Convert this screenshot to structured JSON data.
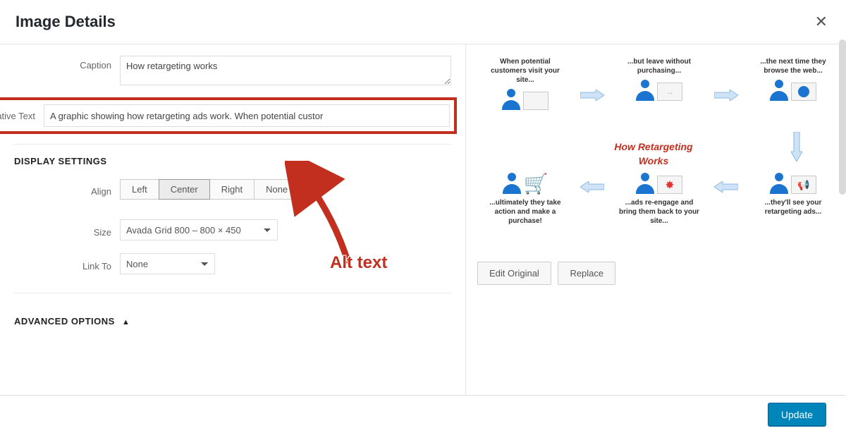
{
  "header": {
    "title": "Image Details"
  },
  "form": {
    "caption_label": "Caption",
    "caption_value": "How retargeting works",
    "alt_label": "Alternative Text",
    "alt_value": "A graphic showing how retargeting ads work. When potential custor"
  },
  "display": {
    "section_title": "DISPLAY SETTINGS",
    "align_label": "Align",
    "align_options": [
      "Left",
      "Center",
      "Right",
      "None"
    ],
    "align_selected": "Center",
    "size_label": "Size",
    "size_value": "Avada Grid 800 – 800 × 450",
    "linkto_label": "Link To",
    "linkto_value": "None"
  },
  "advanced": {
    "title": "ADVANCED OPTIONS"
  },
  "annotation": {
    "callout": "Alt text"
  },
  "preview": {
    "edit_label": "Edit Original",
    "replace_label": "Replace",
    "title": "How Retargeting Works",
    "steps": {
      "s1": "When potential customers visit your site...",
      "s2": "...but leave without purchasing...",
      "s3": "...the next time they browse the web...",
      "s4": "...they'll see your retargeting ads...",
      "s5": "...ads re-engage and bring them back to your site...",
      "s6": "...ultimately they take action and make a purchase!"
    }
  },
  "footer": {
    "update": "Update"
  }
}
